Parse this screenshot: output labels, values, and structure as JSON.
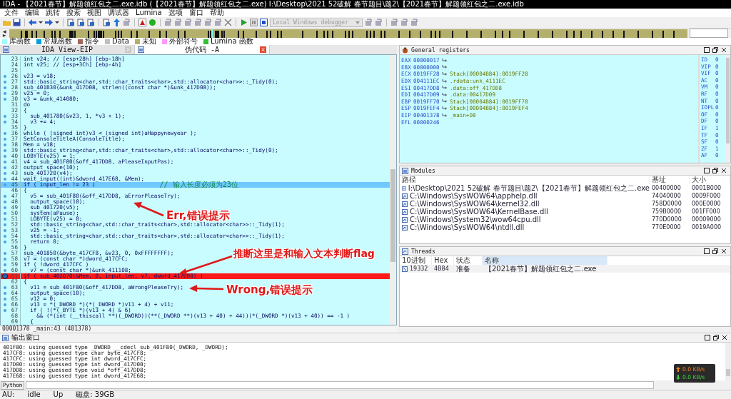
{
  "window": {
    "title": "IDA - 【2021春节】解题领红包之二.exe.idb (【2021春节】解题领红包之二.exe) I:\\Desktop\\2021 52破解 春节题目\\题2\\【2021春节】解题领红包之二.exe.idb"
  },
  "menu": [
    "文件",
    "编辑",
    "跳转",
    "搜索",
    "视图",
    "调试器",
    "Lumina",
    "选项",
    "窗口",
    "帮助"
  ],
  "toolbar": {
    "debugger_select": {
      "value": "Local Windows debugger",
      "disabled": true
    }
  },
  "legend": [
    {
      "label": "库函数",
      "color": "#a0ffff"
    },
    {
      "label": "常规函数",
      "color": "#00a0e0"
    },
    {
      "label": "指令",
      "color": "#a0685a"
    },
    {
      "label": "Data",
      "color": "#c0c0c0"
    },
    {
      "label": "未知",
      "color": "#b4b06c"
    },
    {
      "label": "外部符号",
      "color": "#ff98ff"
    },
    {
      "label": "Lumina 函数",
      "color": "#30c030"
    }
  ],
  "tabs": [
    {
      "label": "IDA View-EIP",
      "selected": false
    },
    {
      "label": "伪代码 -A",
      "selected": true
    }
  ],
  "code": {
    "lines": [
      {
        "num": "23",
        "text": "int v24; // [esp+28h] [ebp-18h]"
      },
      {
        "num": "24",
        "text": "int v25; // [esp+3Ch] [ebp-4h]"
      },
      {
        "num": "25"
      },
      {
        "num": "26",
        "text": "v23 = v18;",
        "dot": true
      },
      {
        "num": "27",
        "text": "std::basic_string<char,std::char_traits<char>,std::allocator<char>>::_Tidy(0);",
        "dot": true
      },
      {
        "num": "28",
        "text": "sub_401B30(&unk_417D08, strlen((const char *)&unk_417D08));",
        "dot": true
      },
      {
        "num": "29",
        "text": "v25 = 0;",
        "dot": true
      },
      {
        "num": "30",
        "text": "v3 = &unk_414080;",
        "dot": true
      },
      {
        "num": "31",
        "text": "do"
      },
      {
        "num": "32",
        "text": "{"
      },
      {
        "num": "33",
        "text": "  sub_401780(&v23, 1, *v3 + 1);",
        "dot": true
      },
      {
        "num": "34",
        "text": "  v3 += 4;",
        "dot": true
      },
      {
        "num": "35",
        "text": "}"
      },
      {
        "num": "36",
        "text": "while ( (signed int)v3 < (signed int)aHappynewyear );",
        "dot": true
      },
      {
        "num": "37",
        "text": "SetConsoleTitleA(ConsoleTitle);",
        "dot": true
      },
      {
        "num": "38",
        "text": "Mem = v18;",
        "dot": true
      },
      {
        "num": "39",
        "text": "std::basic_string<char,std::char_traits<char>,std::allocator<char>>::_Tidy(0);",
        "dot": true
      },
      {
        "num": "40",
        "text": "LOBYTE(v25) = 1;",
        "dot": true
      },
      {
        "num": "41",
        "text": "v4 = sub_401F80(&off_417DD8, aPleaseInputPas);",
        "dot": true
      },
      {
        "num": "42",
        "text": "output_space(10);",
        "dot": true
      },
      {
        "num": "43",
        "text": "sub_401720(v4);",
        "dot": true
      },
      {
        "num": "44",
        "text": "wait_input((int)&dword_417E68, &Mem);",
        "dot": true
      },
      {
        "num": "45",
        "text": "if ( input_len != 23 )",
        "comment": "// 输入长度必须为23位",
        "dot": true,
        "current": true
      },
      {
        "num": "46",
        "text": "{"
      },
      {
        "num": "47",
        "text": "  v5 = sub_401F80(&off_417DD8, aErrorPleaseTry);",
        "dot": true
      },
      {
        "num": "48",
        "text": "  output_space(10);",
        "dot": true
      },
      {
        "num": "49",
        "text": "  sub_401720(v5);",
        "dot": true
      },
      {
        "num": "50",
        "text": "  system(aPause);",
        "dot": true
      },
      {
        "num": "51",
        "text": "  LOBYTE(v25) = 0;",
        "dot": true
      },
      {
        "num": "52",
        "text": "  std::basic_string<char,std::char_traits<char>,std::allocator<char>>::_Tidy(1);",
        "dot": true
      },
      {
        "num": "53",
        "text": "  v25 = -1;",
        "dot": true
      },
      {
        "num": "54",
        "text": "  std::basic_string<char,std::char_traits<char>,std::allocator<char>>::_Tidy(1);",
        "dot": true
      },
      {
        "num": "55",
        "text": "  return 0;",
        "dot": true
      },
      {
        "num": "56",
        "text": "}"
      },
      {
        "num": "57",
        "text": "sub_401850(&byte_417CF8, &v23, 0, 0xFFFFFFFF);",
        "dot": true
      },
      {
        "num": "58",
        "text": "v7 = (const char *)dword_417CFC;",
        "dot": true
      },
      {
        "num": "59",
        "text": "if ( !dword_417CFC )",
        "dot": true
      },
      {
        "num": "60",
        "text": "  v7 = (const char *)&unk_411108;",
        "dot": true
      },
      {
        "num": "61",
        "text": "if ( sub_402070(&Mem, 0, input_len, v7, dword_417D00) )",
        "breakpoint": true
      },
      {
        "num": "62",
        "text": "{"
      },
      {
        "num": "63",
        "text": "  v11 = sub_401F80(&off_417DD8, aWrongPleaseTry);",
        "dot": true
      },
      {
        "num": "64",
        "text": "  output_space(10);",
        "dot": true
      },
      {
        "num": "65",
        "text": "  v12 = 0;",
        "dot": true
      },
      {
        "num": "66",
        "text": "  v13 = *(_DWORD *)(*(_DWORD *)v11 + 4) + v11;",
        "dot": true
      },
      {
        "num": "67",
        "text": "  if ( !(*(_BYTE *)(v13 + 4) & 6)",
        "dot": true
      },
      {
        "num": "68",
        "text": "    && (*(int (__thiscall **)(_DWORD))(**(_DWORD **)(v13 + 40) + 44))(*(_DWORD *)(v13 + 40)) == -1 )"
      },
      {
        "num": "69",
        "text": "  {"
      }
    ],
    "annotations": [
      "Err,错误提示",
      "推断这里是和输入文本判断flag",
      "Wrong,错误提示"
    ],
    "status": "00001378 _main:43 (401378)"
  },
  "registers": {
    "title": "General registers",
    "rows": [
      {
        "name": "EAX",
        "value": "00000017"
      },
      {
        "name": "EBX",
        "value": "00000000"
      },
      {
        "name": "ECX",
        "value": "0019FF28",
        "ref": "Stack[00004B84]:0019FF28"
      },
      {
        "name": "EDX",
        "value": "004111EC",
        "ref": ".rdata:unk_4111EC"
      },
      {
        "name": "ESI",
        "value": "00417DD8",
        "ref": ".data:off_417DD8"
      },
      {
        "name": "EDI",
        "value": "00417D09",
        "ref": ".data:00417D09"
      },
      {
        "name": "EBP",
        "value": "0019FF70",
        "ref": "Stack[00004B84]:0019FF70"
      },
      {
        "name": "ESP",
        "value": "0019FEF4",
        "ref": "Stack[00004B84]:0019FEF4"
      },
      {
        "name": "EIP",
        "value": "00401378",
        "ref": "_main+D8"
      },
      {
        "name": "EFL",
        "value": "00000246"
      }
    ],
    "flags": [
      {
        "name": "ID",
        "value": "0"
      },
      {
        "name": "VIP",
        "value": "0"
      },
      {
        "name": "VIF",
        "value": "0"
      },
      {
        "name": "AC",
        "value": "0"
      },
      {
        "name": "VM",
        "value": "0"
      },
      {
        "name": "RF",
        "value": "0"
      },
      {
        "name": "NT",
        "value": "0"
      },
      {
        "name": "IOPL",
        "value": "0"
      },
      {
        "name": "OF",
        "value": "0"
      },
      {
        "name": "DF",
        "value": "0"
      },
      {
        "name": "IF",
        "value": "1"
      },
      {
        "name": "TF",
        "value": "0"
      },
      {
        "name": "SF",
        "value": "0"
      },
      {
        "name": "ZF",
        "value": "1"
      },
      {
        "name": "AF",
        "value": "0"
      }
    ]
  },
  "modules": {
    "title": "Modules",
    "columns": [
      "路径",
      "基址",
      "大小"
    ],
    "rows": [
      [
        "I:\\Desktop\\2021 52破解 春节题目\\题2\\【2021春节】解题领红包之二.exe",
        "00400000",
        "0001B000"
      ],
      [
        "C:\\Windows\\SysWOW64\\apphelp.dll",
        "74040000",
        "0009F000"
      ],
      [
        "C:\\Windows\\SysWOW64\\kernel32.dll",
        "758D0000",
        "000E0000"
      ],
      [
        "C:\\Windows\\SysWOW64\\KernelBase.dll",
        "759B0000",
        "001FF000"
      ],
      [
        "C:\\Windows\\System32\\wow64cpu.dll",
        "770D0000",
        "00009000"
      ],
      [
        "C:\\Windows\\SysWOW64\\ntdll.dll",
        "770E0000",
        "0019A000"
      ]
    ]
  },
  "threads": {
    "title": "Threads",
    "columns": [
      "10进制",
      "Hex",
      "状态",
      "名称"
    ],
    "rows": [
      [
        "19332",
        "4B84",
        "准备",
        "【2021春节】解题领红包之二.exe"
      ]
    ]
  },
  "output": {
    "title": "输出窗口",
    "lines": [
      "401F80: using guessed type _DWORD __cdecl sub_401F80(_DWORD, _DWORD);",
      "417CF8: using guessed type char byte_417CF8;",
      "417CFC: using guessed type int dword_417CFC;",
      "417D00: using guessed type int dword_417D00;",
      "417DD8: using guessed type void *off_417DD8;",
      "417E68: using guessed type int dword_417E68;"
    ]
  },
  "python_button": "Python",
  "network": {
    "upload": "0.0 KB/s",
    "download": "0.0 KB/s"
  },
  "status_bar": [
    "AU:",
    "idle",
    "Up",
    "磁盘: 39GB"
  ]
}
